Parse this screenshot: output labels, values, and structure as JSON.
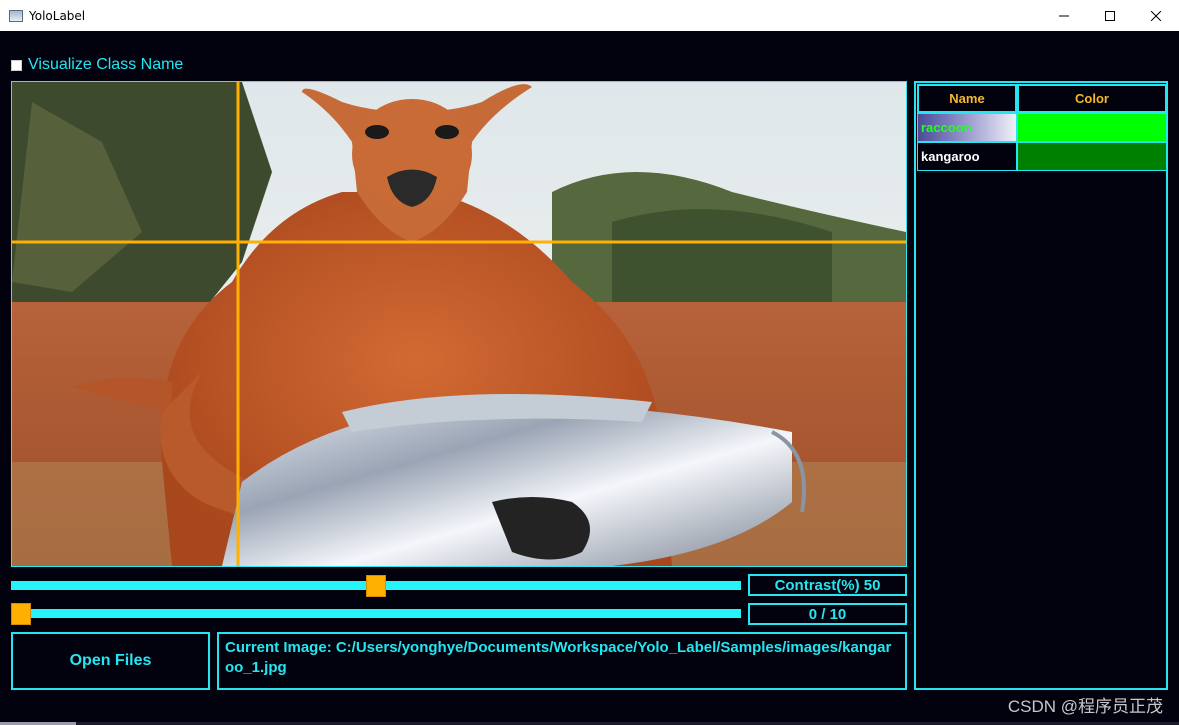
{
  "window": {
    "title": "YoloLabel",
    "icon": "app-window-icon"
  },
  "toolbar": {
    "visualize_label": "Visualize Class Name",
    "visualize_checked": false
  },
  "canvas": {
    "image_subject": "kangaroo-photo",
    "crosshair": true,
    "crosshair_color": "#ffb000"
  },
  "contrast": {
    "label": "Contrast(%) 50",
    "value_percent": 50
  },
  "image_index": {
    "label": "0 / 10",
    "position_fraction": 0.0
  },
  "buttons": {
    "open_files": "Open Files"
  },
  "current_image": {
    "text": "Current Image: C:/Users/yonghye/Documents/Workspace/Yolo_Label/Samples/images/kangaroo_1.jpg"
  },
  "class_table": {
    "headers": [
      "Name",
      "Color"
    ],
    "rows": [
      {
        "name": "raccoon",
        "color": "#00ff00",
        "selected": true
      },
      {
        "name": "kangaroo",
        "color": "#008000",
        "selected": false
      }
    ]
  },
  "colors": {
    "accent": "#25e6f0",
    "header_text": "#f5b82a",
    "background": "#02020e",
    "handle": "#ffb000"
  },
  "watermark": "CSDN @程序员正茂"
}
